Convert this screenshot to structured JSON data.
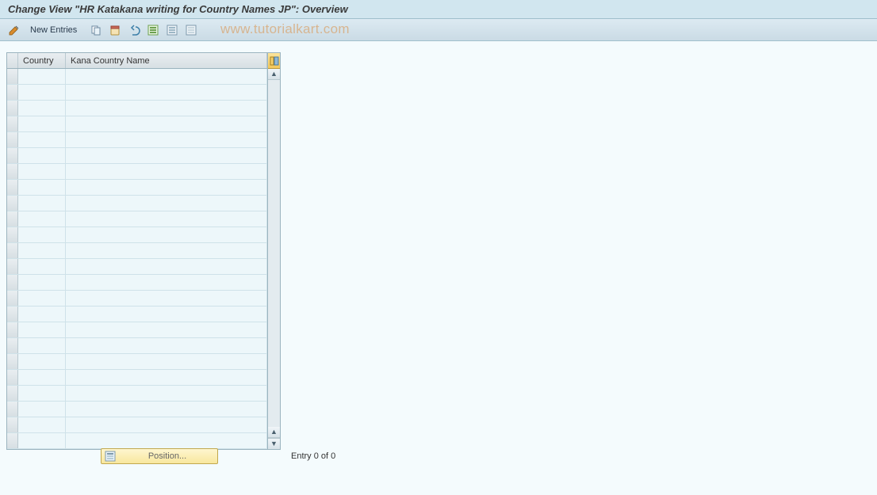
{
  "title": "Change View \"HR Katakana writing for Country Names JP\": Overview",
  "toolbar": {
    "new_entries_label": "New Entries"
  },
  "watermark": "www.tutorialkart.com",
  "table": {
    "columns": {
      "country": "Country",
      "kana": "Kana Country Name"
    },
    "row_count": 24
  },
  "footer": {
    "position_label": "Position...",
    "entry_status": "Entry 0 of 0"
  }
}
